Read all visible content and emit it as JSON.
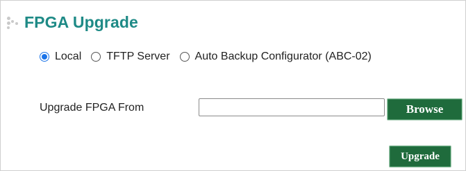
{
  "page": {
    "title": "FPGA Upgrade",
    "title_icon": "dotted-bullet-icon",
    "accent_color": "#1e8a86",
    "button_color": "#1f6b3c"
  },
  "source_options": [
    {
      "label": "Local",
      "checked": true
    },
    {
      "label": "TFTP Server",
      "checked": false
    },
    {
      "label": "Auto Backup Configurator (ABC-02)",
      "checked": false
    }
  ],
  "upgrade_from": {
    "label": "Upgrade FPGA From",
    "file_value": "",
    "browse_label": "Browse"
  },
  "actions": {
    "upgrade_label": "Upgrade"
  }
}
